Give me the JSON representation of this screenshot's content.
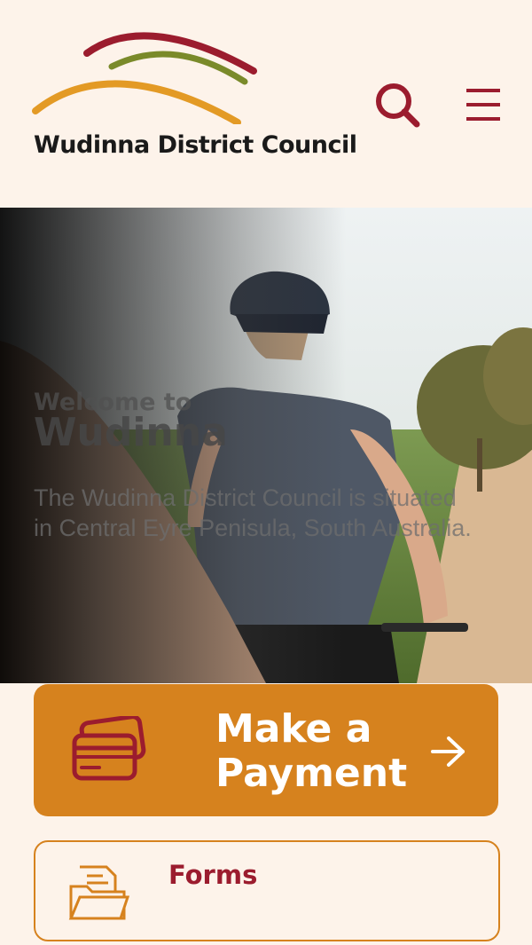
{
  "header": {
    "org_name": "Wudinna District Council",
    "search_icon": "search-icon",
    "menu_icon": "hamburger-menu-icon"
  },
  "hero": {
    "eyebrow": "Welcome to",
    "title": "Wudinna",
    "description": "The Wudinna District Council is situated in Central Eyre Penisula, South Australia."
  },
  "actions": {
    "payment_label": "Make a Payment",
    "payment_icon": "credit-card-icon",
    "payment_arrow_icon": "arrow-right-icon",
    "forms_label": "Forms",
    "forms_icon": "folder-documents-icon"
  },
  "colors": {
    "background": "#fdf3ea",
    "brand_red": "#9b1c2e",
    "brand_orange": "#d6821e",
    "brand_green": "#7a8a2a",
    "text_dark": "#1a1a1a"
  }
}
